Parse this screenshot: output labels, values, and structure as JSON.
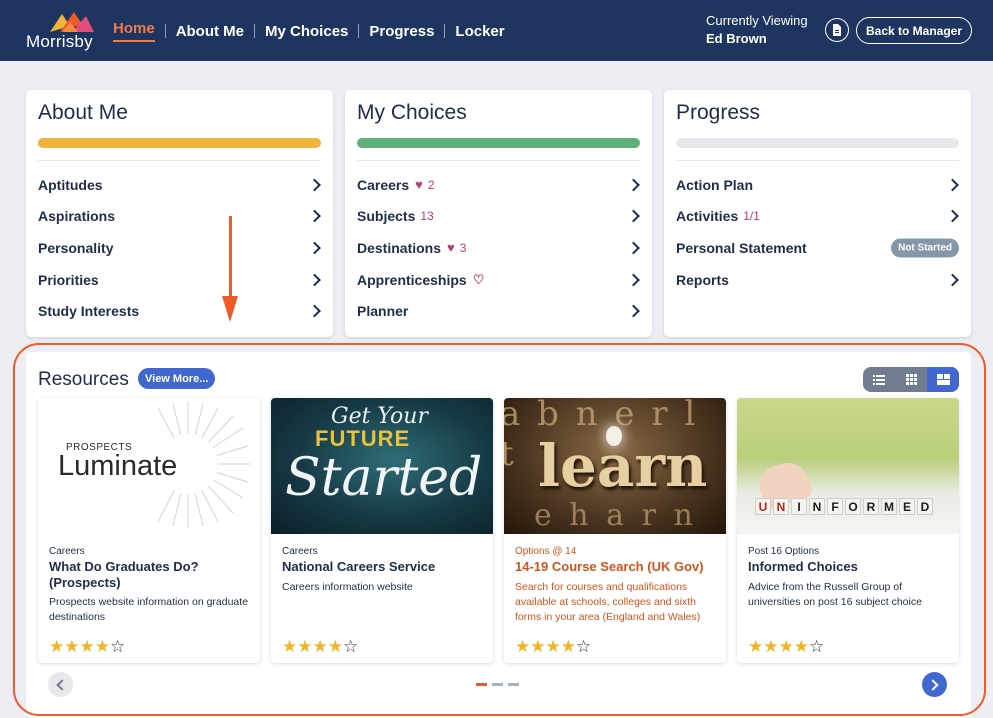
{
  "brand": {
    "logo_text": "Morrisby"
  },
  "nav": [
    {
      "label": "Home",
      "active": true
    },
    {
      "label": "About Me"
    },
    {
      "label": "My Choices"
    },
    {
      "label": "Progress"
    },
    {
      "label": "Locker"
    }
  ],
  "viewing": {
    "label": "Currently Viewing",
    "name": "Ed Brown"
  },
  "header_actions": {
    "document_icon": "document-icon",
    "back_label": "Back to Manager"
  },
  "cards": {
    "about_me": {
      "title": "About Me",
      "progress": 1.0,
      "progress_color": "#f0b43a",
      "items": [
        "Aptitudes",
        "Aspirations",
        "Personality",
        "Priorities",
        "Study Interests"
      ]
    },
    "my_choices": {
      "title": "My Choices",
      "progress": 1.0,
      "progress_color": "#5eb07a",
      "items": [
        {
          "label": "Careers",
          "icon": "heart-filled-icon",
          "count": "2"
        },
        {
          "label": "Subjects",
          "count": "13"
        },
        {
          "label": "Destinations",
          "icon": "heart-filled-icon",
          "count": "3"
        },
        {
          "label": "Apprenticeships",
          "icon": "heart-outline-icon"
        },
        {
          "label": "Planner"
        }
      ]
    },
    "progress": {
      "title": "Progress",
      "progress": 0,
      "items": [
        {
          "label": "Action Plan"
        },
        {
          "label": "Activities",
          "count": "1/1"
        },
        {
          "label": "Personal Statement",
          "status": "Not Started"
        },
        {
          "label": "Reports"
        }
      ]
    }
  },
  "resources": {
    "title": "Resources",
    "view_more": "View More...",
    "view_modes": [
      "list-view-icon",
      "grid-view-icon",
      "card-view-icon"
    ],
    "active_view": "card-view-icon",
    "items": [
      {
        "category": "Careers",
        "name": "What Do Graduates Do? (Prospects)",
        "description": "Prospects website information on graduate destinations",
        "rating": 4,
        "image_text": {
          "top": "PROSPECTS",
          "main": "Luminate"
        }
      },
      {
        "category": "Careers",
        "name": "National Careers Service",
        "description": "Careers information website",
        "rating": 4,
        "image_text": {
          "line1": "Get Your",
          "line2": "FUTURE",
          "line3": "Started"
        }
      },
      {
        "category": "Options @ 14",
        "name": "14-19 Course Search (UK Gov)",
        "description": "Search for courses and qualifications available at schools, colleges and sixth forms in your area (England and Wales)",
        "rating": 4,
        "image_text": {
          "word": "learn"
        }
      },
      {
        "category": "Post 16 Options",
        "name": "Informed Choices",
        "description": "Advice from the Russell Group of universities on post 16 subject choice",
        "rating": 4,
        "image_text": {
          "letters": [
            "U",
            "N",
            "I",
            "N",
            "F",
            "O",
            "R",
            "M",
            "E",
            "D"
          ]
        }
      }
    ],
    "carousel": {
      "pages": 3,
      "current": 1
    }
  }
}
